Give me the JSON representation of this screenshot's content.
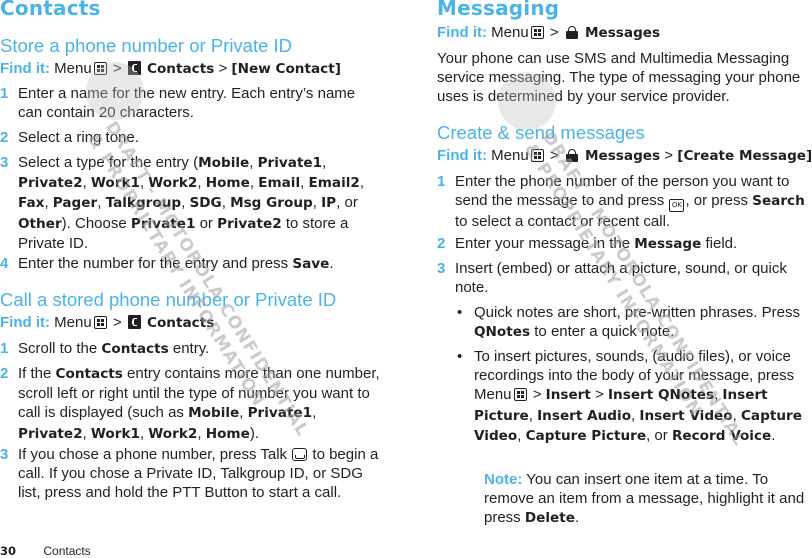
{
  "left": {
    "title": "Contacts",
    "section1": {
      "heading": "Store a phone number or Private ID",
      "findit": {
        "label": "Find it:",
        "menu": "Menu",
        "sep": ">",
        "item1": "Contacts",
        "item2": "[New Contact]"
      },
      "steps": [
        {
          "num": "1",
          "text": "Enter a name for the new entry. Each entry’s name can contain 20 characters."
        },
        {
          "num": "2",
          "text": "Select a ring tone."
        },
        {
          "num": "3",
          "text_pre": "Select a type for the entry (",
          "types": [
            "Mobile",
            "Private1",
            "Private2",
            "Work1",
            "Work2",
            "Home",
            "Email",
            "Email2",
            "Fax",
            "Pager",
            "Talkgroup",
            "SDG",
            "Msg Group",
            "IP"
          ],
          "or": "or",
          "last_type": "Other",
          "text_mid": "). Choose",
          "opt1": "Private1",
          "opt2": "Private2",
          "text_post": "to store a Private ID."
        },
        {
          "num": "4",
          "text_pre": "Enter the number for the entry and press",
          "action": "Save",
          "text_post": "."
        }
      ]
    },
    "section2": {
      "heading": "Call a stored phone number or Private ID",
      "findit": {
        "label": "Find it:",
        "menu": "Menu",
        "sep": ">",
        "item1": "Contacts"
      },
      "steps": [
        {
          "num": "1",
          "text_pre": "Scroll to the",
          "bold": "Contacts",
          "text_post": "entry."
        },
        {
          "num": "2",
          "text_pre": "If the",
          "bold": "Contacts",
          "text_mid": "entry contains more than one number, scroll left or right until the type of number you want to call is displayed (such as",
          "types": [
            "Mobile",
            "Private1",
            "Private2",
            "Work1",
            "Work2",
            "Home"
          ],
          "text_post": ")."
        },
        {
          "num": "3",
          "text_pre": "If you chose a phone number, press Talk",
          "text_post": "to begin a call. If you chose a Private ID, Talkgroup ID, or SDG list, press and hold the PTT Button to start a call."
        }
      ]
    }
  },
  "right": {
    "title": "Messaging",
    "findit": {
      "label": "Find it:",
      "menu": "Menu",
      "sep": ">",
      "item1": "Messages"
    },
    "intro": "Your phone can use SMS and Multimedia Messaging service messaging. The type of messaging your phone uses is determined by your service provider.",
    "section": {
      "heading": "Create & send messages",
      "findit": {
        "label": "Find it:",
        "menu": "Menu",
        "sep": ">",
        "item1": "Messages",
        "item2": "[Create Message]"
      },
      "steps": [
        {
          "num": "1",
          "text_pre": "Enter the phone number of the person you want to send the message to and press",
          "ok_icon": "OK",
          "text_mid": ", or press",
          "bold": "Search",
          "text_post": "to select a contact or recent call."
        },
        {
          "num": "2",
          "text_pre": "Enter your message in the",
          "bold": "Message",
          "text_post": "field."
        },
        {
          "num": "3",
          "text": "Insert (embed) or attach a picture, sound, or quick note."
        }
      ],
      "bullets": [
        {
          "text_pre": "Quick notes are short, pre-written phrases. Press",
          "bold": "QNotes",
          "text_post": "to enter a quick note."
        },
        {
          "text_pre": "To insert pictures, sounds, (audio files), or voice recordings into the body of your message, press Menu",
          "path": [
            "Insert",
            "Insert QNotes"
          ],
          "options": [
            "Insert Picture",
            "Insert Audio",
            "Insert Video",
            "Capture Video",
            "Capture Picture"
          ],
          "or": "or",
          "last": "Record Voice"
        }
      ],
      "note": {
        "label": "Note:",
        "text_pre": "You can insert one item at a time. To remove an item from a message, highlight it and press",
        "bold": "Delete",
        "text_post": "."
      }
    }
  },
  "footer": {
    "page_number": "30",
    "section": "Contacts"
  },
  "watermark": {
    "line1": "DRAFT - MOTOROLA CONFIDENTIAL",
    "line2": "& PROPRIETARY INFORMATION"
  },
  "colors": {
    "accent": "#4bb4e6",
    "text": "#231f20"
  }
}
